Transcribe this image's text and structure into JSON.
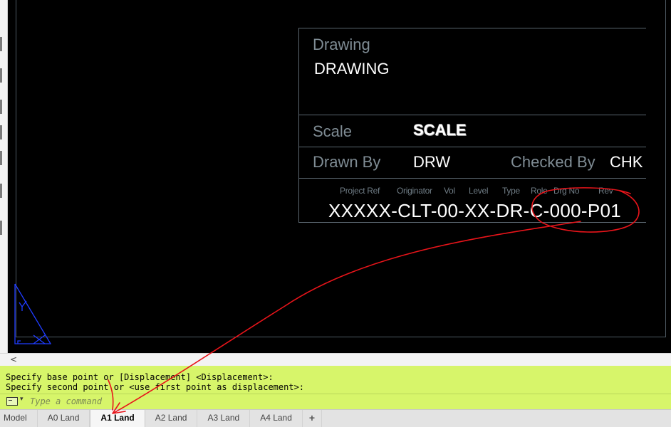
{
  "title_block": {
    "drawing_label": "Drawing",
    "drawing_value": "DRAWING",
    "scale_label": "Scale",
    "scale_value": "SCALE",
    "drawn_by_label": "Drawn By",
    "drawn_by_value": "DRW",
    "checked_by_label": "Checked By",
    "checked_by_value": "CHK",
    "number_headers": {
      "project_ref": "Project Ref",
      "originator": "Originator",
      "vol": "Vol",
      "level": "Level",
      "type": "Type",
      "role": "Role",
      "drg_no": "Drg No",
      "rev": "Rev"
    },
    "drawing_number": "XXXXX-CLT-00-XX-DR-C-000-P01"
  },
  "scrollbar": {
    "left_arrow": "<"
  },
  "command": {
    "history": [
      "Specify base point or [Displacement] <Displacement>:",
      "Specify second point or <use first point as displacement>:"
    ],
    "dropdown_glyph": "▾",
    "placeholder": "Type a command"
  },
  "layout_tabs": [
    {
      "label": "Model",
      "active": false
    },
    {
      "label": "A0 Land",
      "active": false
    },
    {
      "label": "A1 Land",
      "active": true
    },
    {
      "label": "A2 Land",
      "active": false
    },
    {
      "label": "A3 Land",
      "active": false
    },
    {
      "label": "A4 Land",
      "active": false
    }
  ],
  "add_tab_glyph": "+",
  "colors": {
    "canvas": "#000000",
    "command_bg": "#d7f56a",
    "annotation": "#e8141a",
    "ucs_icon": "#1f3cff"
  }
}
